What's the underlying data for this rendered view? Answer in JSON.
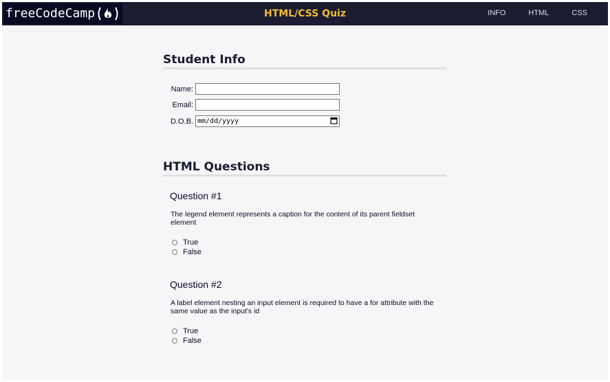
{
  "navbar": {
    "logo_text": "freeCodeCamp",
    "logo_glyph": "(🔥)",
    "title": "HTML/CSS Quiz",
    "links": [
      "INFO",
      "HTML",
      "CSS"
    ]
  },
  "student_info": {
    "heading": "Student Info",
    "name_label": "Name:",
    "email_label": "Email:",
    "dob_label": "D.O.B.",
    "dob_placeholder": "mm/dd/yyyy"
  },
  "html_questions": {
    "heading": "HTML Questions",
    "questions": [
      {
        "title": "Question #1",
        "text": "The legend element represents a caption for the content of its parent fieldset element",
        "options": [
          "True",
          "False"
        ]
      },
      {
        "title": "Question #2",
        "text": "A label element nesting an input element is required to have a for attribute with the same value as the input's id",
        "options": [
          "True",
          "False"
        ]
      }
    ]
  },
  "colors": {
    "navbar_bg": "#1b1b32",
    "title_accent": "#f1be32",
    "page_bg": "#f5f6f7"
  }
}
